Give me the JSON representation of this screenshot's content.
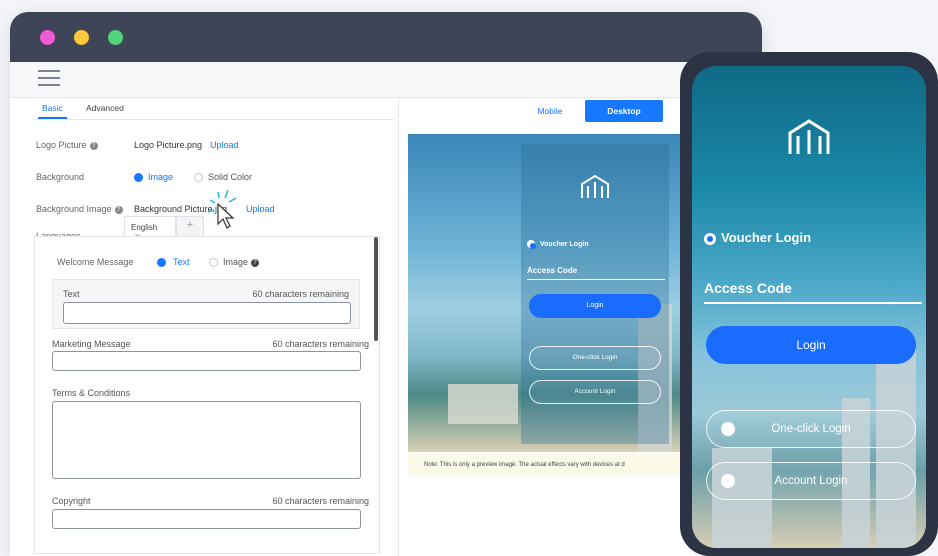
{
  "window": {
    "dots": [
      "#f05ad7",
      "#ffc83d",
      "#4fd47a"
    ]
  },
  "basic_panel": {
    "tabs": [
      {
        "label": "Basic"
      },
      {
        "label": "Advanced"
      }
    ],
    "logo_picture": {
      "label": "Logo Picture",
      "value": "Logo Picture.png",
      "link": "Upload"
    },
    "background": {
      "label": "Background",
      "options": [
        "Image",
        "Solid Color"
      ],
      "selected": "Image"
    },
    "background_image": {
      "label": "Background Image",
      "value": "Background Picture.jpg",
      "link": "Upload"
    },
    "languages": {
      "label": "Languages",
      "tab": "English",
      "add": "+"
    },
    "welcome_message": {
      "label": "Welcome Message",
      "options": [
        "Text",
        "Image"
      ],
      "selected": "Text"
    },
    "text_field": {
      "label": "Text",
      "hint": "60 characters remaining",
      "value": ""
    },
    "marketing_message": {
      "label": "Marketing Message",
      "hint": "60 characters remaining",
      "value": ""
    },
    "terms": {
      "label": "Terms & Conditions",
      "value": ""
    },
    "copyright": {
      "label": "Copyright",
      "hint": "60 characters remaining",
      "value": ""
    }
  },
  "preview": {
    "view_toggle": [
      "Mobile",
      "Desktop"
    ],
    "selected_view": "Desktop",
    "voucher_login": "Voucher Login",
    "access_code": "Access Code",
    "login_button": "Login",
    "one_click_login": "One-click Login",
    "account_login": "Account Login",
    "note": "Note: This is only a preview image. The actual effects vary with devices at d"
  },
  "phone": {
    "voucher_login": "Voucher Login",
    "access_code": "Access Code",
    "login_button": "Login",
    "one_click_login": "One-click Login",
    "account_login": "Account Login"
  },
  "colors": {
    "accent": "#1677ff",
    "login_blue": "#1a6cff",
    "titlebar": "#3e4556"
  }
}
